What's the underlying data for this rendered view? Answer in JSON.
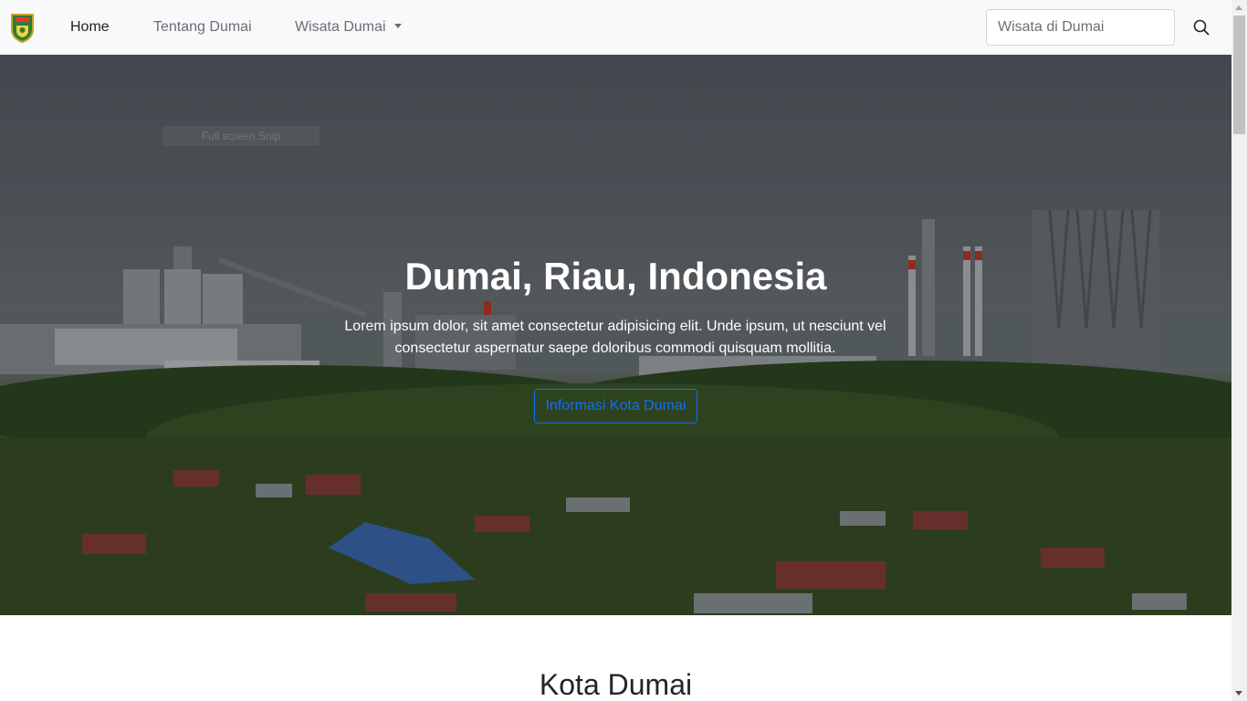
{
  "nav": {
    "links": [
      {
        "label": "Home",
        "active": true
      },
      {
        "label": "Tentang Dumai",
        "active": false
      },
      {
        "label": "Wisata Dumai",
        "active": false,
        "dropdown": true
      }
    ],
    "search": {
      "value": "",
      "placeholder": "Wisata di Dumai",
      "icon": "search-icon"
    },
    "logo_icon": "dumai-emblem-icon"
  },
  "hero": {
    "ghost_label": "Full screen Snip",
    "title": "Dumai, Riau, Indonesia",
    "text": "Lorem ipsum dolor, sit amet consectetur adipisicing elit. Unde ipsum, ut nesciunt vel consectetur aspernatur saepe doloribus commodi quisquam mollitia.",
    "button_label": "Informasi Kota Dumai"
  },
  "section": {
    "title": "Kota Dumai"
  },
  "colors": {
    "accent": "#0d6efd",
    "navbar_bg": "#f8f9fa"
  }
}
